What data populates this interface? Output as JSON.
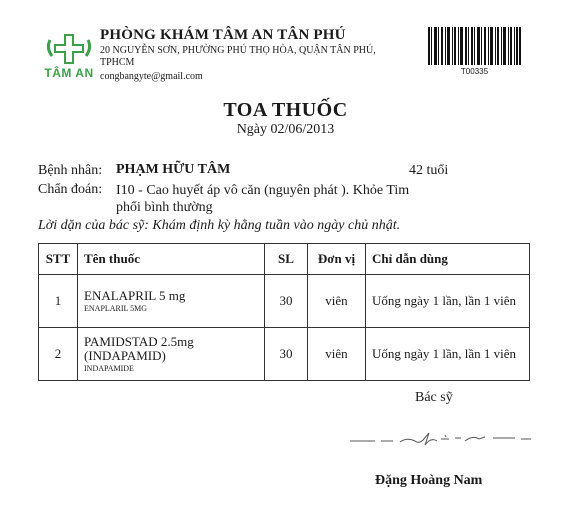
{
  "clinic": {
    "logo_text": "TÂM AN",
    "name": "PHÒNG KHÁM TÂM AN TÂN PHÚ",
    "address": "20 NGUYỄN SƠN, PHƯỜNG PHÚ THỌ HÒA, QUẬN TÂN PHÚ, TPHCM",
    "email": "congbangyte@gmail.com",
    "barcode_code": "T00335",
    "brand_color": "#3aa14a"
  },
  "document": {
    "title": "TOA THUỐC",
    "date": "Ngày 02/06/2013"
  },
  "patient": {
    "label": "Bệnh nhân:",
    "name": "PHẠM HỮU TÂM",
    "age": "42 tuổi",
    "diagnosis_label": "Chẩn đoán:",
    "diagnosis": "I10 - Cao huyết áp vô căn (nguyên phát ). Khỏe Tim phổi bình thường",
    "advice": "Lời dặn của bác sỹ: Khám định kỳ hằng tuần vào ngày chủ nhật."
  },
  "table": {
    "headers": [
      "STT",
      "Tên thuốc",
      "SL",
      "Đơn vị",
      "Chỉ dẫn dùng"
    ],
    "rows": [
      {
        "stt": "1",
        "name": "ENALAPRIL 5 mg",
        "generic": "ENAPLARIL 5MG",
        "qty": "30",
        "unit": "viên",
        "instructions": "Uống ngày 1 lần, lần 1 viên"
      },
      {
        "stt": "2",
        "name": "PAMIDSTAD 2.5mg (INDAPAMID)",
        "generic": "INDAPAMIDE",
        "qty": "30",
        "unit": "viên",
        "instructions": "Uống ngày 1 lần, lần 1 viên"
      }
    ]
  },
  "doctor": {
    "role": "Bác sỹ",
    "name": "Đặng Hoàng Nam"
  }
}
